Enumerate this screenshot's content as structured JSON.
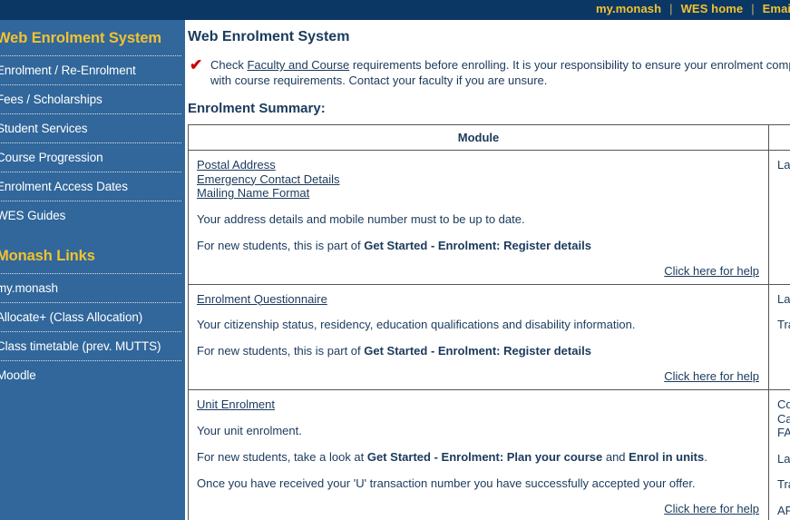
{
  "topbar": {
    "links": [
      {
        "label": "my.monash"
      },
      {
        "label": "WES home"
      },
      {
        "label": "Email Portal"
      }
    ],
    "separator": "|",
    "link_color": "#f2c230",
    "bg_color": "#0b3765"
  },
  "sidebar": {
    "bg_color": "#31679b",
    "heading_color": "#f2c230",
    "sections": [
      {
        "title": "Web Enrolment System",
        "items": [
          {
            "label": "Enrolment / Re-Enrolment"
          },
          {
            "label": "Fees / Scholarships"
          },
          {
            "label": "Student Services"
          },
          {
            "label": "Course Progression"
          },
          {
            "label": "Enrolment Access Dates"
          },
          {
            "label": "WES Guides"
          }
        ]
      },
      {
        "title": "Monash Links",
        "items": [
          {
            "label": "my.monash"
          },
          {
            "label": "Allocate+ (Class Allocation)"
          },
          {
            "label": "Class timetable (prev. MUTTS)"
          },
          {
            "label": "Moodle"
          }
        ]
      }
    ]
  },
  "main": {
    "page_title": "Web Enrolment System",
    "notice": {
      "icon": "red-check-icon",
      "icon_color": "#cc0000",
      "text_before": "Check ",
      "link": "Faculty and Course",
      "text_after": " requirements before enrolling. It is your responsibility to ensure your enrolment complies with course requirements. Contact your faculty if you are unsure."
    },
    "summary_title": "Enrolment Summary:",
    "table": {
      "headers": [
        "Module",
        ""
      ],
      "help_label": "Click here for help",
      "rows": [
        {
          "links": [
            "Postal Address",
            "Emergency Contact Details",
            "Mailing Name Format"
          ],
          "paragraphs": [
            {
              "plain": "Your address details and mobile number must to be up to date."
            }
          ],
          "guidance_prefix": "For new students, this is part of ",
          "guidance_bold": "Get Started",
          "guidance_mid": " - ",
          "guidance_bold2": "Enrolment: Register details",
          "guidance_suffix": "",
          "status": [
            "Las"
          ]
        },
        {
          "links": [
            "Enrolment Questionnaire"
          ],
          "paragraphs": [
            {
              "plain": "Your citizenship status, residency, education qualifications and disability information."
            }
          ],
          "guidance_prefix": "For new students, this is part of ",
          "guidance_bold": "Get Started",
          "guidance_mid": " - ",
          "guidance_bold2": "Enrolment: Register details",
          "guidance_suffix": "",
          "status": [
            "Las",
            "Tra"
          ]
        },
        {
          "links": [
            "Unit Enrolment"
          ],
          "paragraphs": [
            {
              "plain": "Your unit enrolment."
            }
          ],
          "guidance_prefix": "For new students, take a look at ",
          "guidance_bold": "Get Started",
          "guidance_mid": " - ",
          "guidance_bold2": "Enrolment: Plan your course",
          "guidance_suffix": " and ",
          "guidance_bold3": "Enrol in units",
          "guidance_end": ".",
          "extra_paragraph": "Once you have received your 'U' transaction number you have successfully accepted your offer.",
          "status": [
            "Co",
            "Ca",
            "FA",
            "Las",
            "Tra",
            "AP"
          ]
        }
      ]
    }
  }
}
